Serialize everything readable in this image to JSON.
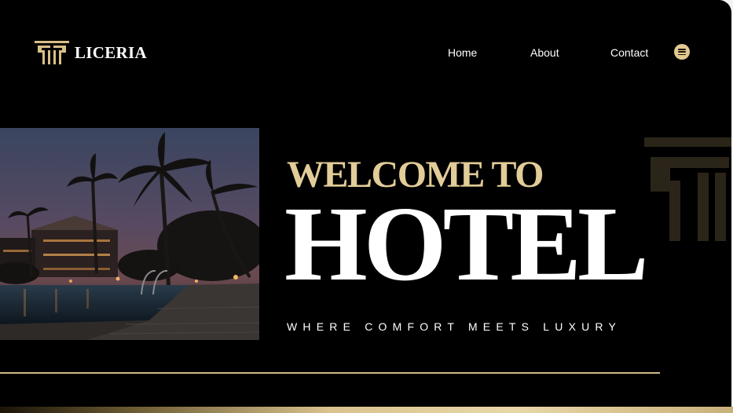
{
  "brand": {
    "name": "LICERIA",
    "logo_icon": "pillar-logo-icon",
    "accent_color": "#e2c98f"
  },
  "nav": {
    "items": [
      {
        "label": "Home"
      },
      {
        "label": "About"
      },
      {
        "label": "Contact"
      }
    ],
    "menu_icon": "hamburger-menu-icon"
  },
  "hero": {
    "welcome": "WELCOME TO",
    "title": "HOTEL",
    "tagline": "WHERE COMFORT MEETS LUXURY",
    "image": "night-resort-pool-palm-trees-photo",
    "decoration_icon": "pillar-watermark-icon"
  },
  "colors": {
    "background": "#000000",
    "gold": "#e2cc98",
    "text": "#ffffff"
  }
}
